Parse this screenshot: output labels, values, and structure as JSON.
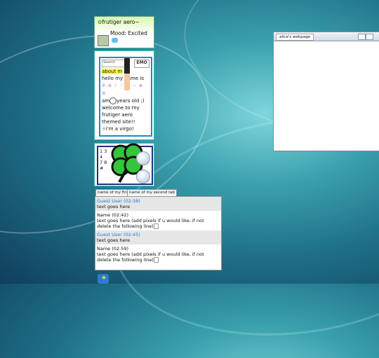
{
  "profile": {
    "header_title": "frutiger aero~",
    "mood_label": "Mood: Excited",
    "search_placeholder": "Search",
    "emo_label": "EMO",
    "about_highlight": "about m",
    "about_lines": [
      "hello my name is",
      "am",
      "years old ;)",
      "welcome to my",
      "frutiger aero",
      "themed site!!",
      "i'm a virgo!"
    ],
    "glyph_row": "ꕤ ✿ ♪ ♡ ✧ ☆ ❀ ✿"
  },
  "widget": {
    "lines": [
      "1 3",
      "4",
      "7 8",
      "#"
    ]
  },
  "tabs": [
    {
      "label": "name of my first tab"
    },
    {
      "label": "name of my second tab"
    }
  ],
  "comments": [
    {
      "name": "Guest User (02:38)",
      "text": "text goes here",
      "guest": true
    },
    {
      "name": "Name (02:42)",
      "text": "text goes here (add pixels if u would like, if not delete the following line)",
      "guest": false
    },
    {
      "name": "Guest User (02:45)",
      "text": "text goes here",
      "guest": true
    },
    {
      "name": "Name (02:59)",
      "text": "text goes here (add pixels if u would like, if not delete the following line)",
      "guest": false
    }
  ],
  "window": {
    "title": "alice's webpage"
  },
  "colors": {
    "guest_name": "#2277cc",
    "window_border": "#7a8a9a"
  }
}
